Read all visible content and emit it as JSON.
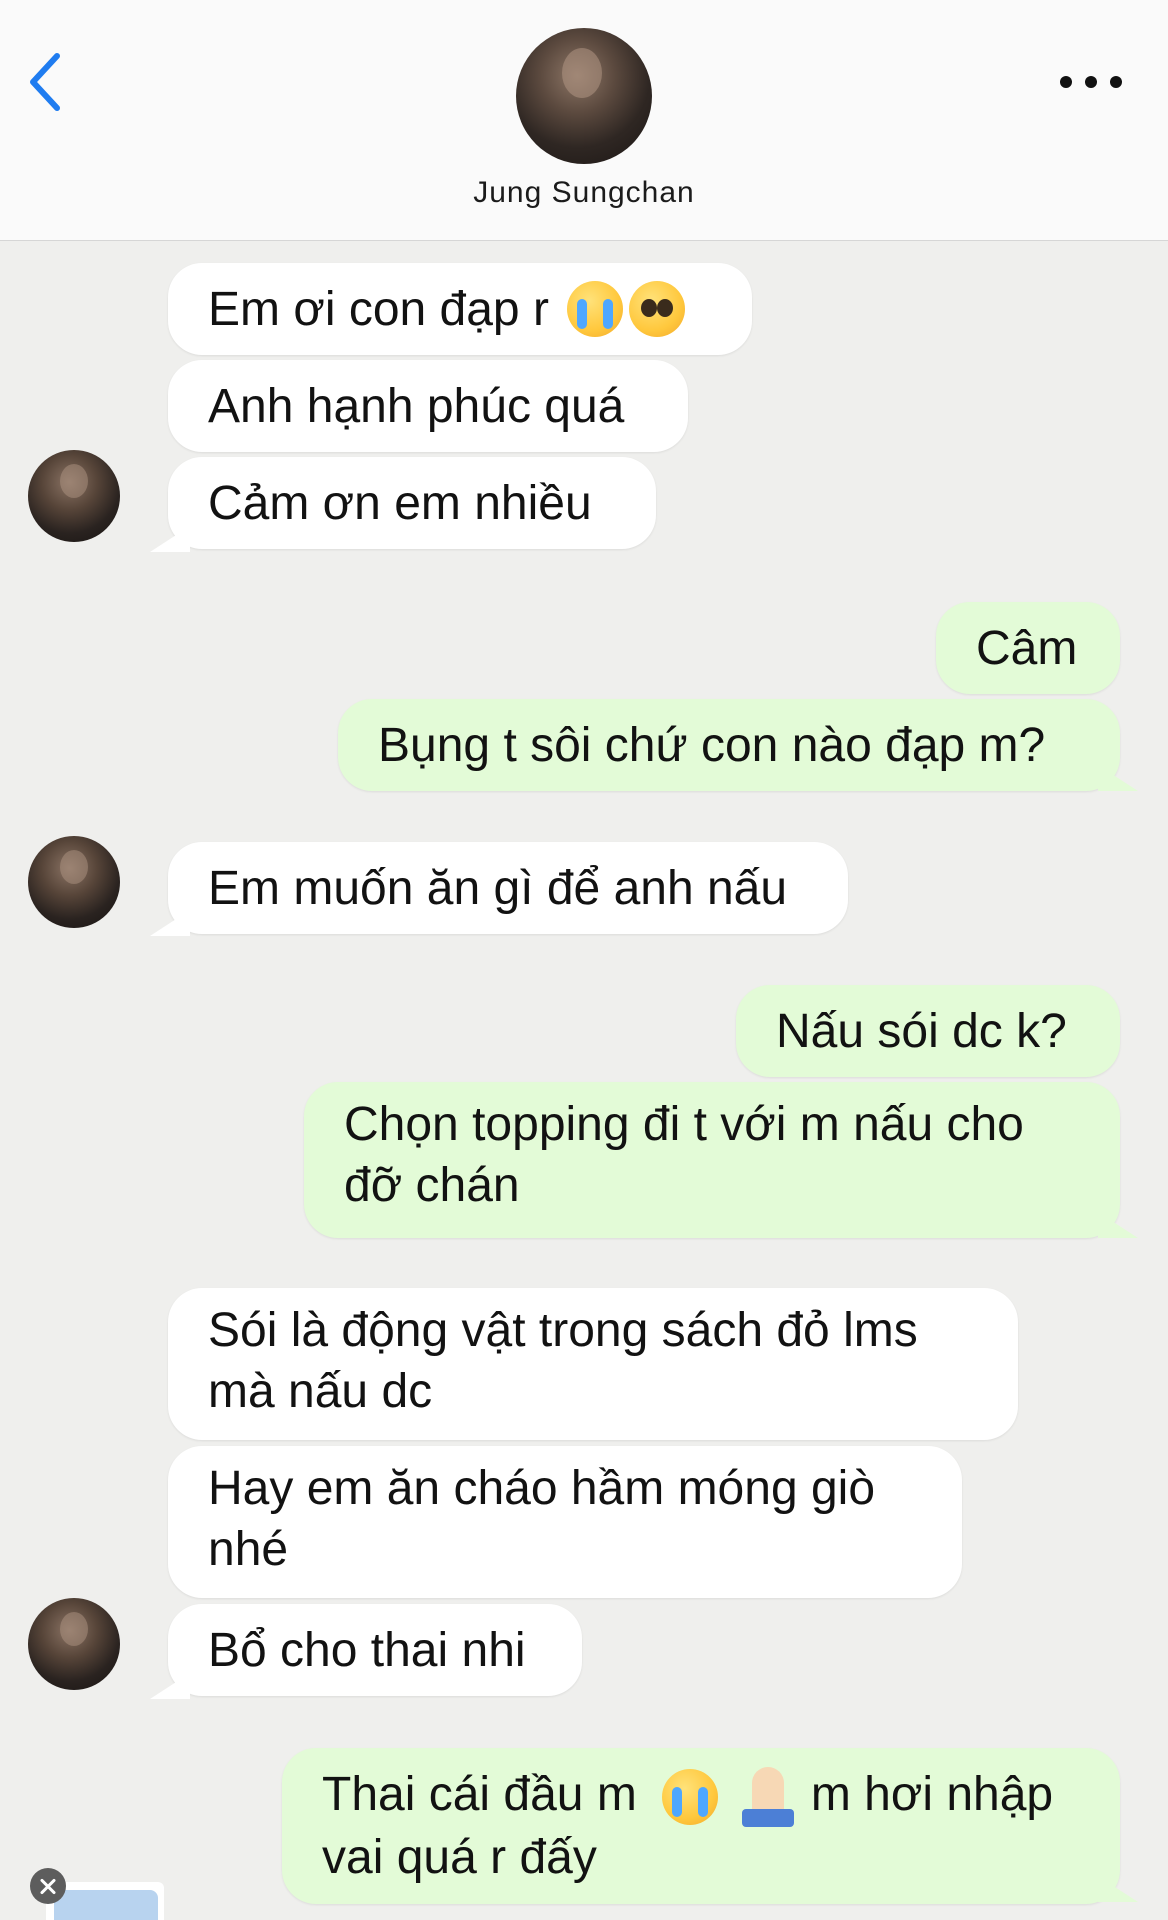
{
  "header": {
    "contact_name": "Jung Sungchan",
    "back_icon": "chevron-left-icon",
    "more_icon": "more-dots-icon",
    "accent_color": "#1f7cf0"
  },
  "messages": [
    {
      "sender": "contact",
      "text": "Em ơi con đạp r",
      "emojis": [
        "loudly-crying-face",
        "pleading-face"
      ]
    },
    {
      "sender": "contact",
      "text": "Anh hạnh phúc quá"
    },
    {
      "sender": "contact",
      "text": "Cảm ơn em nhiều"
    },
    {
      "sender": "me",
      "text": "Câm"
    },
    {
      "sender": "me",
      "text": "Bụng t sôi chứ con nào đạp m?"
    },
    {
      "sender": "contact",
      "text": "Em muốn ăn gì để anh nấu"
    },
    {
      "sender": "me",
      "text": "Nấu sói dc k?"
    },
    {
      "sender": "me",
      "text": "Chọn topping đi t với m nấu cho đỡ chán"
    },
    {
      "sender": "contact",
      "text": "Sói là động vật trong sách đỏ lms mà nấu dc"
    },
    {
      "sender": "contact",
      "text": "Hay em ăn cháo hầm móng giò nhé"
    },
    {
      "sender": "contact",
      "text": "Bổ cho thai nhi"
    },
    {
      "sender": "me",
      "text_before": "Thai cái đầu m",
      "emojis": [
        "loudly-crying-face",
        "folded-hands"
      ],
      "text_after": "m hơi nhập vai quá r đấy"
    }
  ],
  "colors": {
    "background": "#efefed",
    "incoming_bubble": "#ffffff",
    "outgoing_bubble": "#e3fbd7"
  }
}
